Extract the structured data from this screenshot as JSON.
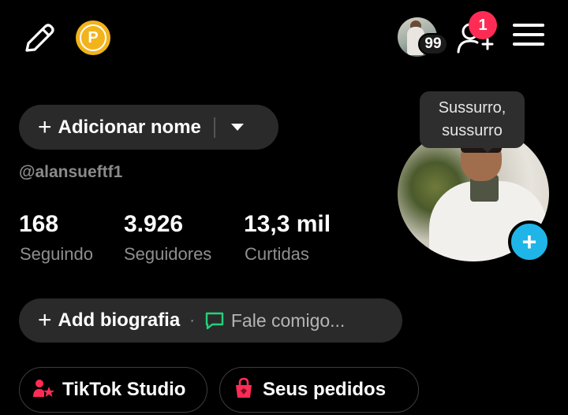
{
  "header": {
    "edit_icon": "pencil-icon",
    "coin_letter": "P",
    "avatar_badge": "99",
    "notification_count": "1"
  },
  "profile": {
    "add_name_label": "Adicionar nome",
    "username": "@alansueftf1",
    "whisper_bubble_line1": "Sussurro,",
    "whisper_bubble_line2": "sussurro"
  },
  "stats": [
    {
      "value": "168",
      "label": "Seguindo"
    },
    {
      "value": "3.926",
      "label": "Seguidores"
    },
    {
      "value": "13,3 mil",
      "label": "Curtidas"
    }
  ],
  "bio": {
    "add_bio_label": "Add biografia",
    "separator": "·",
    "message_hint": "Fale comigo..."
  },
  "actions": {
    "studio_label": "TikTok Studio",
    "orders_label": "Seus pedidos"
  },
  "colors": {
    "background": "#000000",
    "pill": "#2a2a2a",
    "notification": "#fe2c55",
    "accent_blue": "#20b5e8",
    "coin": "#f2b31c",
    "studio_icon": "#fe2c55",
    "orders_icon": "#fe2c55",
    "chat_icon": "#25d07a"
  }
}
